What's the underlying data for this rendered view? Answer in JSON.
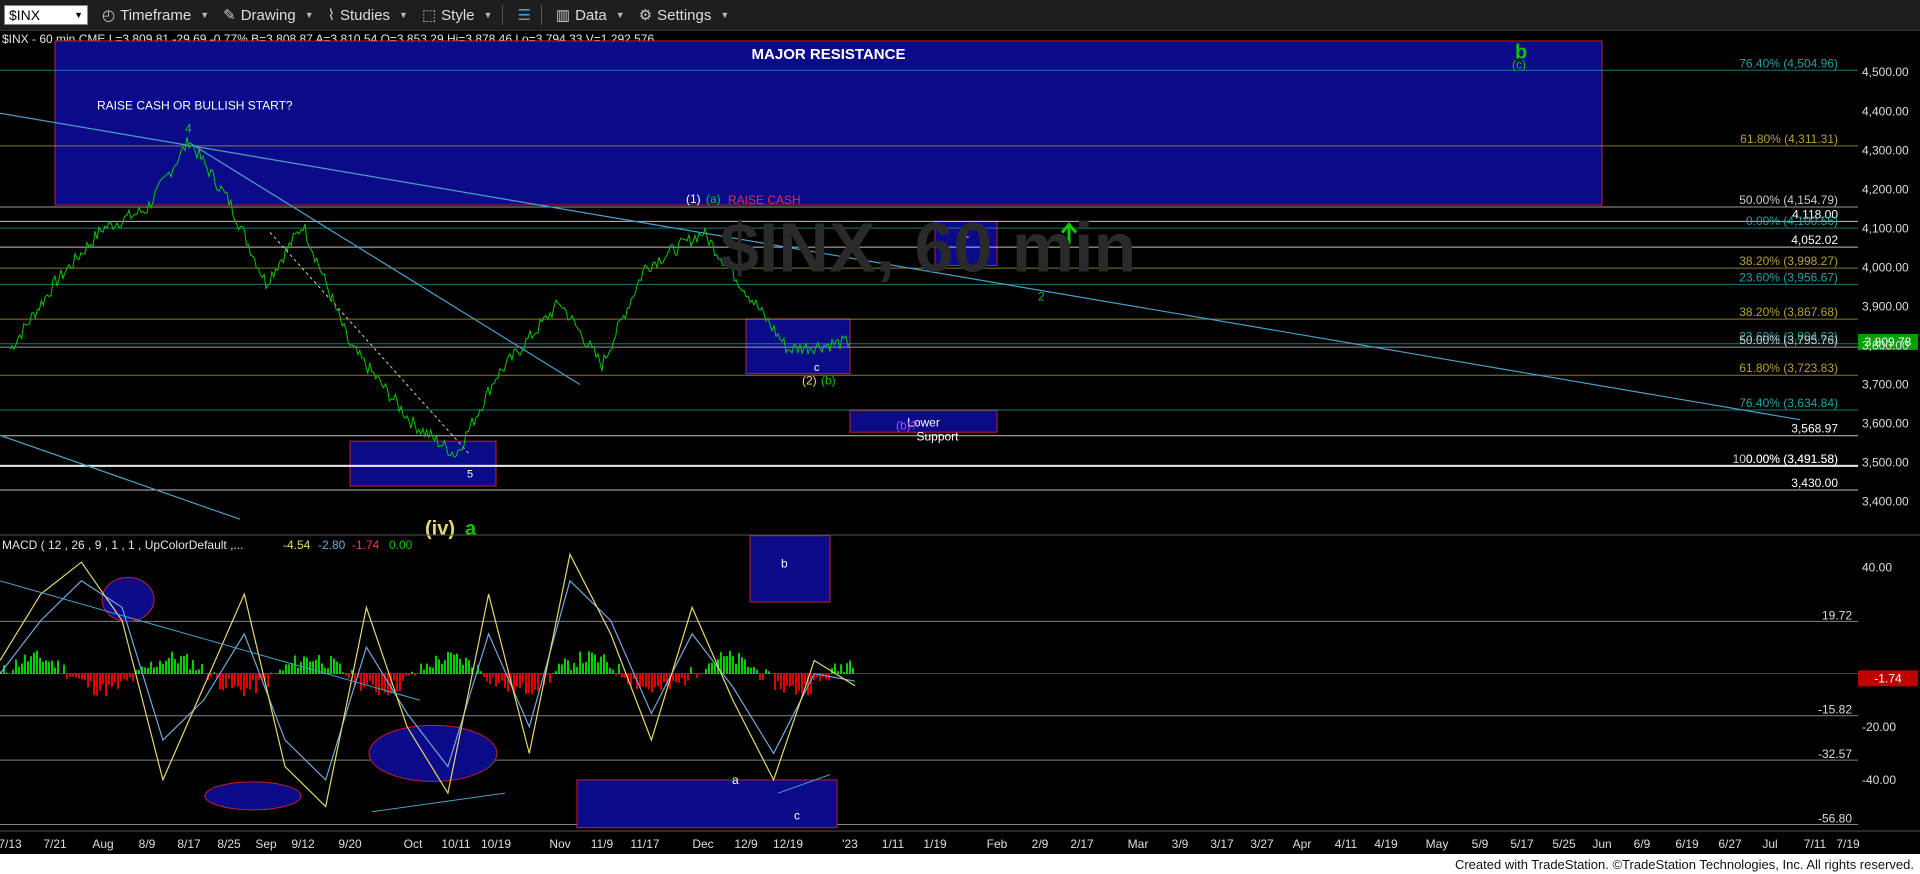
{
  "toolbar": {
    "symbol": "$INX",
    "timeframe_label": "Timeframe",
    "drawing_label": "Drawing",
    "studies_label": "Studies",
    "style_label": "Style",
    "data_label": "Data",
    "settings_label": "Settings"
  },
  "header": {
    "quote_line": "$INX - 60 min  CME  L=3,809.81  -29.69  -0.77%  B=3,808.87  A=3,810.54  O=3,853.29  Hi=3,878.46  Lo=3,794.33  V=1,292,576",
    "macd_line_prefix": "MACD ( 12 , 26 , 9 , 1 , 1 , UpColorDefault ,...",
    "macd_v1": "-4.54",
    "macd_v2": "-2.80",
    "macd_v3": "-1.74",
    "macd_v4": "0.00"
  },
  "footer": {
    "credit": "Created with TradeStation. ©TradeStation Technologies, Inc. All rights reserved."
  },
  "colors": {
    "zone_fill": "#0b0b8a",
    "zone_border": "#c0202c",
    "price_line": "#00c800",
    "trend_line": "#4aa0c8",
    "macd_fast": "#e6d86a",
    "macd_slow": "#6fa8d8",
    "hist_up": "#00d000",
    "hist_down": "#e00000",
    "current_price_bg": "#00a000"
  },
  "chart_data": [
    {
      "type": "line",
      "title": "$INX - 60 min",
      "x_ticks": [
        "7/13",
        "7/21",
        "Aug",
        "8/9",
        "8/17",
        "8/25",
        "Sep",
        "9/12",
        "9/20",
        "Oct",
        "10/11",
        "10/19",
        "Nov",
        "11/9",
        "11/17",
        "Dec",
        "12/9",
        "12/19",
        "'23",
        "1/11",
        "1/19",
        "Feb",
        "2/9",
        "2/17",
        "Mar",
        "3/9",
        "3/17",
        "3/27",
        "Apr",
        "4/11",
        "4/19",
        "May",
        "5/9",
        "5/17",
        "5/25",
        "Jun",
        "6/9",
        "6/19",
        "6/27",
        "Jul",
        "7/11",
        "7/19"
      ],
      "y_ticks": [
        "3,400.00",
        "3,500.00",
        "3,600.00",
        "3,700.00",
        "3,800.00",
        "3,900.00",
        "4,000.00",
        "4,100.00",
        "4,200.00",
        "4,300.00",
        "4,400.00",
        "4,500.00"
      ],
      "ylim": [
        3330,
        4580
      ],
      "current_price": "3,809.78",
      "series": [
        {
          "values": [
            {
              "x": "7/13",
              "y": 3790
            },
            {
              "x": "7/21",
              "y": 3960
            },
            {
              "x": "Aug",
              "y": 4100
            },
            {
              "x": "8/9",
              "y": 4150
            },
            {
              "x": "8/17",
              "y": 4325
            },
            {
              "x": "8/25",
              "y": 4170
            },
            {
              "x": "Sep",
              "y": 3960
            },
            {
              "x": "9/12",
              "y": 4110
            },
            {
              "x": "9/20",
              "y": 3800
            },
            {
              "x": "Oct",
              "y": 3600
            },
            {
              "x": "10/11",
              "y": 3520
            },
            {
              "x": "10/19",
              "y": 3720
            },
            {
              "x": "Nov",
              "y": 3910
            },
            {
              "x": "11/9",
              "y": 3750
            },
            {
              "x": "11/17",
              "y": 4000
            },
            {
              "x": "Dec",
              "y": 4090
            },
            {
              "x": "12/9",
              "y": 3940
            },
            {
              "x": "12/19",
              "y": 3790
            },
            {
              "x": "'23",
              "y": 3809
            }
          ]
        }
      ],
      "horizontal_levels": [
        {
          "label": "76.40% (4,504.96)",
          "y": 4504.96,
          "color": "#21a0a0"
        },
        {
          "label": "61.80% (4,311.31)",
          "y": 4311.31,
          "color": "#b8a030"
        },
        {
          "label": "50.00% (4,154.79)",
          "y": 4154.79,
          "color": "#cccccc"
        },
        {
          "label": "4,118.00",
          "y": 4118,
          "color": "#ffffff"
        },
        {
          "label": "0.00% (4,100.56)",
          "y": 4100.56,
          "color": "#21a0a0"
        },
        {
          "label": "4,052.02",
          "y": 4052.02,
          "color": "#ffffff"
        },
        {
          "label": "38.20% (3,998.27)",
          "y": 3998.27,
          "color": "#b8a030"
        },
        {
          "label": "23.60% (3,956.67)",
          "y": 3956.67,
          "color": "#21a0a0"
        },
        {
          "label": "38.20% (3,867.68)",
          "y": 3867.68,
          "color": "#b8a030"
        },
        {
          "label": "23.60% (3,804.63)",
          "y": 3804.63,
          "color": "#21a0a0"
        },
        {
          "label": "50.00% (3,795.76)",
          "y": 3795.76,
          "color": "#cccccc"
        },
        {
          "label": "61.80% (3,723.83)",
          "y": 3723.83,
          "color": "#b8a030"
        },
        {
          "label": "76.40% (3,634.84)",
          "y": 3634.84,
          "color": "#21a0a0"
        },
        {
          "label": "3,568.97",
          "y": 3568.97,
          "color": "#ffffff"
        },
        {
          "label": "100.00% (3,491.58)",
          "y": 3491.58,
          "color": "#cccccc"
        },
        {
          "label": "0.00% (3,491.58)",
          "y": 3491.58,
          "color": "#ffffff"
        },
        {
          "label": "3,430.00",
          "y": 3430,
          "color": "#ffffff"
        }
      ],
      "zones": [
        {
          "label": "MAJOR RESISTANCE",
          "x0": "7/21",
          "x1": "Jun",
          "y0": 4160,
          "y1": 4580
        },
        {
          "label": "",
          "x0": "9/20",
          "x1": "10/19",
          "y0": 3440,
          "y1": 3555
        },
        {
          "label": "",
          "x0": "12/9",
          "x1": "'23",
          "y0": 3728,
          "y1": 3868
        },
        {
          "label": "1",
          "x0": "1/19",
          "x1": "Feb",
          "y0": 4005,
          "y1": 4118
        },
        {
          "label": "Lower",
          "sublabel": "Support",
          "x0": "'23",
          "x1": "Feb",
          "y0": 3578,
          "y1": 3634
        }
      ],
      "annotations": [
        {
          "text": "RAISE CASH OR BULLISH START?",
          "color": "#ffffff"
        },
        {
          "text": "RAISE CASH",
          "color": "#e03040"
        },
        {
          "text": "(iv)",
          "color": "#e6d86a"
        },
        {
          "text": "a",
          "color": "#00c800"
        },
        {
          "text": "b",
          "color": "#00c800"
        },
        {
          "text": "(c)",
          "color": "#00c800"
        },
        {
          "text": "4",
          "color": "#00c800"
        },
        {
          "text": "(1)",
          "color": "#ffffff"
        },
        {
          "text": "(a)",
          "color": "#00c800"
        },
        {
          "text": "(2)",
          "color": "#e6d86a"
        },
        {
          "text": "(b)",
          "color": "#00c800"
        },
        {
          "text": "(b)?",
          "color": "#c040ff"
        },
        {
          "text": "2",
          "color": "#00c800"
        },
        {
          "text": "c",
          "color": "#ffffff"
        },
        {
          "text": "5",
          "color": "#ffffff"
        }
      ]
    },
    {
      "type": "line",
      "title": "MACD ( 12 , 26 , 9 , 1 , 1 , UpColorDefault ,...",
      "y_ticks": [
        "40.00",
        "-20.00",
        "-40.00"
      ],
      "ylim": [
        -60,
        50
      ],
      "levels": [
        {
          "label": "19.72",
          "y": 19.72
        },
        {
          "label": "-15.82",
          "y": -15.82
        },
        {
          "label": "-32.57",
          "y": -32.57
        },
        {
          "label": "-56.80",
          "y": -56.8
        }
      ],
      "current_value": "-1.74",
      "series": [
        {
          "name": "MACD",
          "values": [
            5,
            30,
            42,
            20,
            -40,
            -5,
            30,
            -35,
            -50,
            25,
            -20,
            -45,
            30,
            -30,
            45,
            15,
            -25,
            25,
            -10,
            -40,
            5,
            -4.54
          ]
        },
        {
          "name": "Signal",
          "values": [
            0,
            20,
            35,
            25,
            -25,
            -10,
            15,
            -25,
            -40,
            10,
            -15,
            -35,
            15,
            -20,
            35,
            20,
            -15,
            15,
            -5,
            -30,
            0,
            -2.8
          ]
        }
      ],
      "annotations": [
        {
          "text": "b",
          "color": "#ffffff"
        },
        {
          "text": "a",
          "color": "#ffffff"
        },
        {
          "text": "c",
          "color": "#ffffff"
        }
      ]
    }
  ]
}
